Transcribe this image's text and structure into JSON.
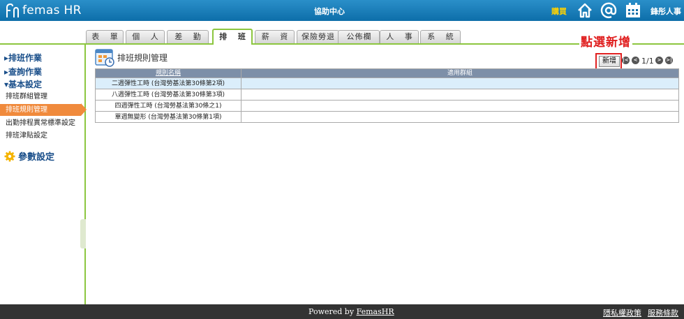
{
  "header": {
    "logo_text": "femas HR",
    "help_center": "協助中心",
    "buy": "購買",
    "user_name": "鋒彤人事",
    "brand_color": "#0d6ea9",
    "icons": [
      "home-icon",
      "at-icon",
      "calendar-icon"
    ]
  },
  "tabs": [
    {
      "label": "表 單",
      "active": false
    },
    {
      "label": "個 人",
      "active": false
    },
    {
      "label": "差 勤",
      "active": false
    },
    {
      "label": "排 班",
      "active": true
    },
    {
      "label": "薪 資",
      "active": false
    },
    {
      "label": "保險勞退",
      "active": false
    },
    {
      "label": "公佈欄",
      "active": false
    },
    {
      "label": "人 事",
      "active": false
    },
    {
      "label": "系 統",
      "active": false
    }
  ],
  "annotation": "點選新增",
  "sidebar": {
    "groups": [
      "▸排班作業",
      "▸查詢作業",
      "▾基本設定"
    ],
    "items": [
      {
        "label": "排班群組管理",
        "active": false
      },
      {
        "label": "排班規則管理",
        "active": true
      },
      {
        "label": "出勤排程異常標準設定",
        "active": false
      },
      {
        "label": "排班津貼設定",
        "active": false
      }
    ],
    "param_label": "參數設定",
    "accent_color": "#f08a3c"
  },
  "main": {
    "title": "排班規則管理",
    "add_label": "新增",
    "pager": {
      "text": "1/1"
    },
    "table": {
      "headers": [
        "規則名稱",
        "適用群組"
      ],
      "rows": [
        [
          "二週彈性工時 (台灣勞基法第30條第2項)",
          ""
        ],
        [
          "八週彈性工時 (台灣勞基法第30條第3項)",
          ""
        ],
        [
          "四週彈性工時 (台灣勞基法第30條之1)",
          ""
        ],
        [
          "單週無變形 (台灣勞基法第30條第1項)",
          ""
        ]
      ]
    }
  },
  "footer": {
    "powered_prefix": "Powered by ",
    "powered_link": "FemasHR",
    "privacy": "隱私權政策",
    "terms": "服務條款"
  }
}
